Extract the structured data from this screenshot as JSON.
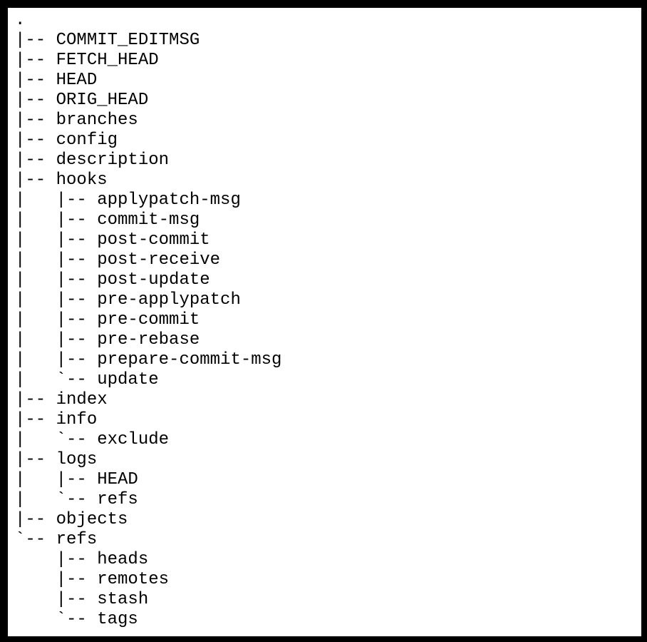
{
  "view": {
    "kind": "terminal-tree-output",
    "command_style": "tree",
    "background_color": "#ffffff",
    "text_color": "#000000",
    "border_color": "#000000",
    "root_label": "."
  },
  "tree": {
    "root": ".",
    "lines": [
      ".",
      "|-- COMMIT_EDITMSG",
      "|-- FETCH_HEAD",
      "|-- HEAD",
      "|-- ORIG_HEAD",
      "|-- branches",
      "|-- config",
      "|-- description",
      "|-- hooks",
      "|   |-- applypatch-msg",
      "|   |-- commit-msg",
      "|   |-- post-commit",
      "|   |-- post-receive",
      "|   |-- post-update",
      "|   |-- pre-applypatch",
      "|   |-- pre-commit",
      "|   |-- pre-rebase",
      "|   |-- prepare-commit-msg",
      "|   `-- update",
      "|-- index",
      "|-- info",
      "|   `-- exclude",
      "|-- logs",
      "|   |-- HEAD",
      "|   `-- refs",
      "|-- objects",
      "`-- refs",
      "    |-- heads",
      "    |-- remotes",
      "    |-- stash",
      "    `-- tags"
    ],
    "entries": [
      {
        "name": ".",
        "depth": 0,
        "connector": "",
        "last": false
      },
      {
        "name": "COMMIT_EDITMSG",
        "depth": 1,
        "connector": "|--",
        "last": false
      },
      {
        "name": "FETCH_HEAD",
        "depth": 1,
        "connector": "|--",
        "last": false
      },
      {
        "name": "HEAD",
        "depth": 1,
        "connector": "|--",
        "last": false
      },
      {
        "name": "ORIG_HEAD",
        "depth": 1,
        "connector": "|--",
        "last": false
      },
      {
        "name": "branches",
        "depth": 1,
        "connector": "|--",
        "last": false
      },
      {
        "name": "config",
        "depth": 1,
        "connector": "|--",
        "last": false
      },
      {
        "name": "description",
        "depth": 1,
        "connector": "|--",
        "last": false
      },
      {
        "name": "hooks",
        "depth": 1,
        "connector": "|--",
        "last": false
      },
      {
        "name": "applypatch-msg",
        "depth": 2,
        "connector": "|--",
        "last": false
      },
      {
        "name": "commit-msg",
        "depth": 2,
        "connector": "|--",
        "last": false
      },
      {
        "name": "post-commit",
        "depth": 2,
        "connector": "|--",
        "last": false
      },
      {
        "name": "post-receive",
        "depth": 2,
        "connector": "|--",
        "last": false
      },
      {
        "name": "post-update",
        "depth": 2,
        "connector": "|--",
        "last": false
      },
      {
        "name": "pre-applypatch",
        "depth": 2,
        "connector": "|--",
        "last": false
      },
      {
        "name": "pre-commit",
        "depth": 2,
        "connector": "|--",
        "last": false
      },
      {
        "name": "pre-rebase",
        "depth": 2,
        "connector": "|--",
        "last": false
      },
      {
        "name": "prepare-commit-msg",
        "depth": 2,
        "connector": "|--",
        "last": false
      },
      {
        "name": "update",
        "depth": 2,
        "connector": "`--",
        "last": true
      },
      {
        "name": "index",
        "depth": 1,
        "connector": "|--",
        "last": false
      },
      {
        "name": "info",
        "depth": 1,
        "connector": "|--",
        "last": false
      },
      {
        "name": "exclude",
        "depth": 2,
        "connector": "`--",
        "last": true
      },
      {
        "name": "logs",
        "depth": 1,
        "connector": "|--",
        "last": false
      },
      {
        "name": "HEAD",
        "depth": 2,
        "connector": "|--",
        "last": false
      },
      {
        "name": "refs",
        "depth": 2,
        "connector": "`--",
        "last": true
      },
      {
        "name": "objects",
        "depth": 1,
        "connector": "|--",
        "last": false
      },
      {
        "name": "refs",
        "depth": 1,
        "connector": "`--",
        "last": true
      },
      {
        "name": "heads",
        "depth": 2,
        "connector": "|--",
        "last": false
      },
      {
        "name": "remotes",
        "depth": 2,
        "connector": "|--",
        "last": false
      },
      {
        "name": "stash",
        "depth": 2,
        "connector": "|--",
        "last": false
      },
      {
        "name": "tags",
        "depth": 2,
        "connector": "`--",
        "last": true
      }
    ]
  }
}
